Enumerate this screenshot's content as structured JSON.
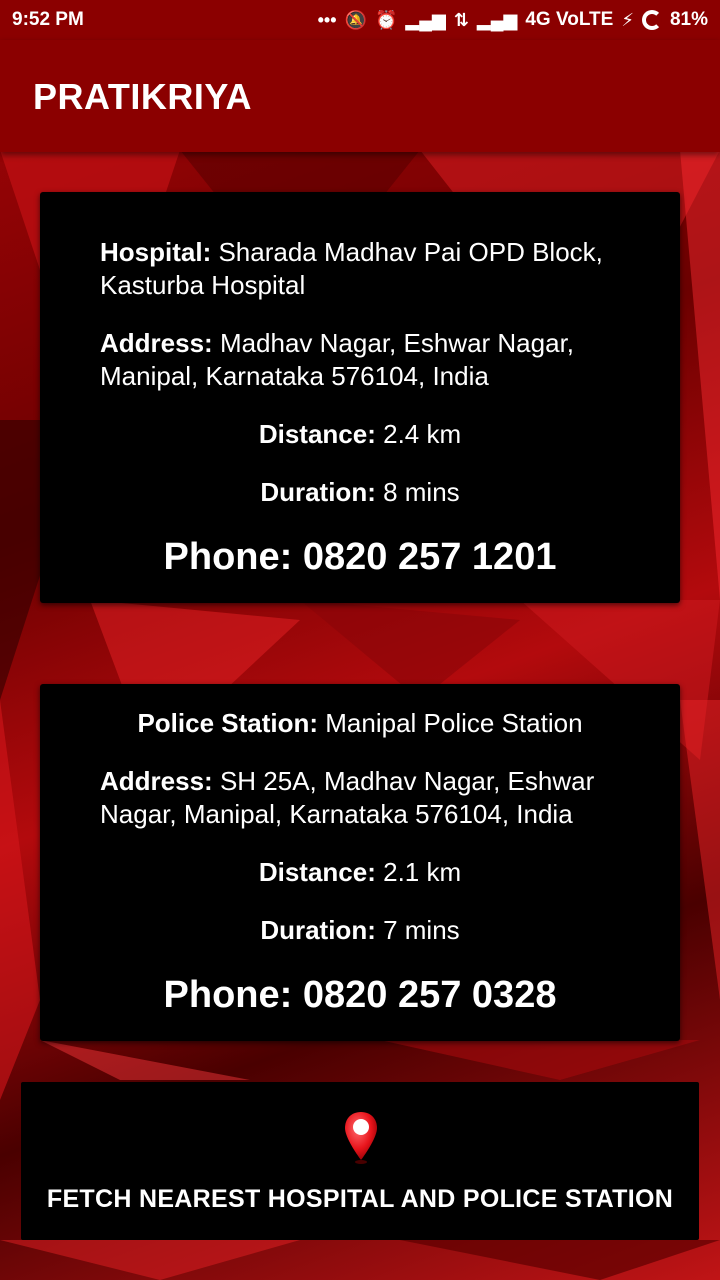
{
  "status_bar": {
    "time": "9:52 PM",
    "network": "4G VoLTE",
    "battery": "81%",
    "icons": [
      "more-dots-icon",
      "silent-icon",
      "alarm-icon",
      "signal-icon",
      "data-arrows-icon",
      "signal-icon",
      "charging-icon",
      "battery-ring-icon"
    ]
  },
  "app_bar": {
    "title": "PRATIKRIYA"
  },
  "hospital": {
    "name_label": "Hospital:",
    "name": "Sharada Madhav Pai OPD Block, Kasturba Hospital",
    "address_label": "Address:",
    "address": "Madhav Nagar, Eshwar Nagar, Manipal, Karnataka 576104, India",
    "distance_label": "Distance:",
    "distance": "2.4 km",
    "duration_label": "Duration:",
    "duration": "8 mins",
    "phone_label": "Phone:",
    "phone": "0820 257 1201"
  },
  "police": {
    "name_label": "Police Station:",
    "name": "Manipal Police Station",
    "address_label": "Address:",
    "address": "SH 25A, Madhav Nagar, Eshwar Nagar, Manipal, Karnataka 576104, India",
    "distance_label": "Distance:",
    "distance": "2.1 km",
    "duration_label": "Duration:",
    "duration": "7 mins",
    "phone_label": "Phone:",
    "phone": "0820 257 0328"
  },
  "fetch_button": {
    "label": "FETCH NEAREST HOSPITAL AND POLICE STATION",
    "icon": "location-pin-icon"
  },
  "colors": {
    "app_bar": "#8b0000",
    "card": "#000000",
    "text": "#ffffff",
    "pin": "#e8141b"
  }
}
